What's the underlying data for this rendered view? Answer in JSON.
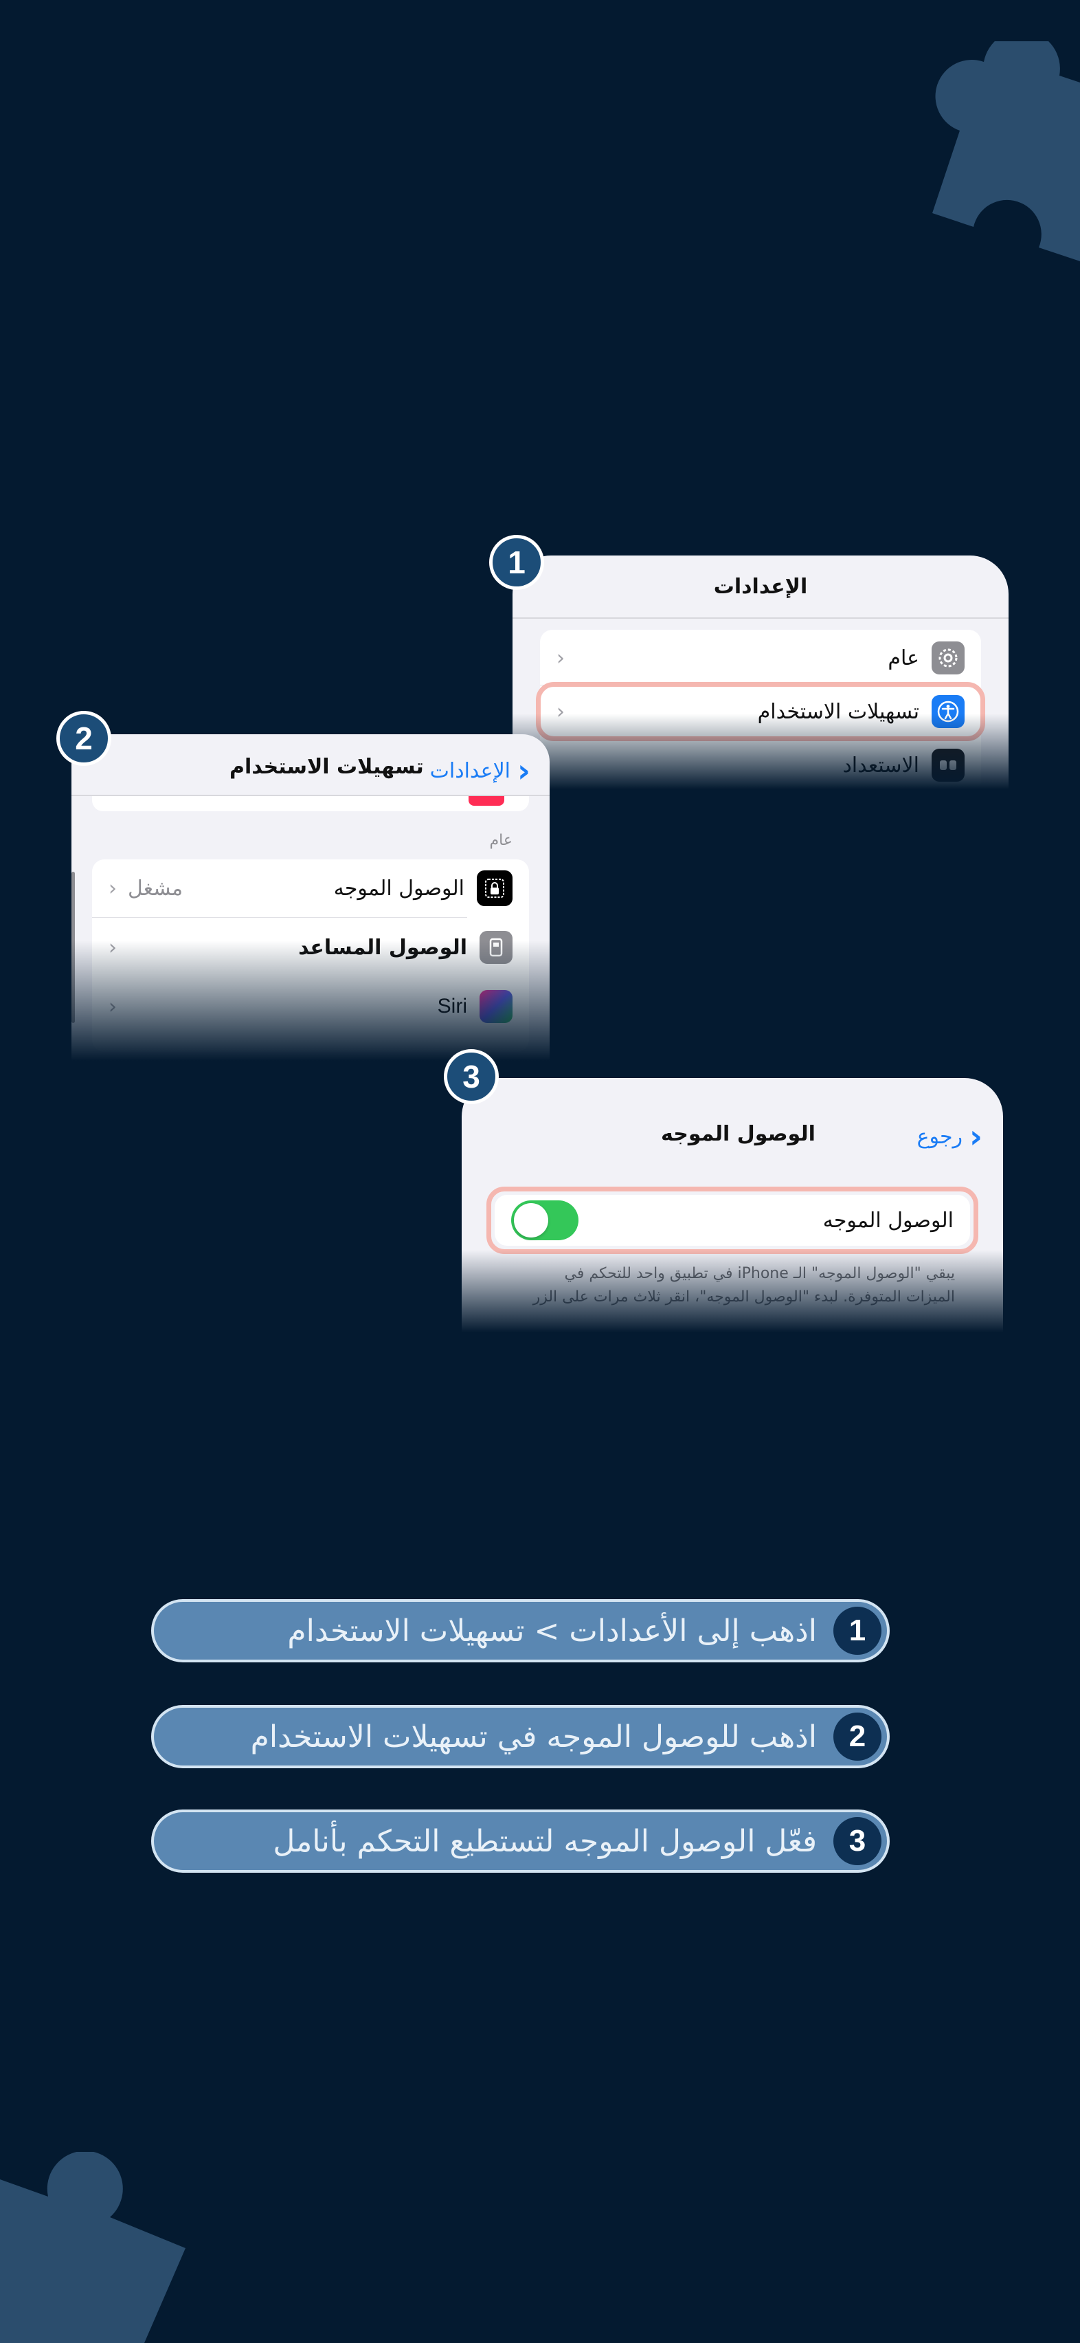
{
  "card1": {
    "badge": "1",
    "title": "الإعدادات",
    "rows": [
      {
        "label": "عام",
        "icon": "gear-icon"
      },
      {
        "label": "تسهيلات الاستخدام",
        "icon": "accessibility-icon"
      },
      {
        "label": "الاستعداد",
        "icon": "standby-icon"
      }
    ]
  },
  "card2": {
    "badge": "2",
    "back_label": "الإعدادات",
    "title": "تسهيلات الاستخدام",
    "section_header": "عام",
    "rows": [
      {
        "label": "الوصول الموجه",
        "value": "مشغل",
        "icon": "lock-icon"
      },
      {
        "label": "الوصول المساعد",
        "icon": "assistive-access-icon"
      },
      {
        "label": "Siri",
        "icon": "siri-icon"
      }
    ]
  },
  "card3": {
    "badge": "3",
    "back_label": "رجوع",
    "title": "الوصول الموجه",
    "toggle_label": "الوصول الموجه",
    "toggle_on": true,
    "footer_line1": "يبقي \"الوصول الموجه\" الـ iPhone في تطبيق واحد للتحكم في",
    "footer_line2": "الميزات المتوفرة. لبدء \"الوصول الموجه\"، انقر ثلاث مرات على الزر"
  },
  "steps": [
    {
      "num": "1",
      "text": "اذهب إلى الأعدادات > تسهيلات الاستخدام"
    },
    {
      "num": "2",
      "text": "اذهب للوصول الموجه في تسهيلات الاستخدام"
    },
    {
      "num": "3",
      "text": "فعّل الوصول الموجه لتستطيع التحكم بأنامل"
    }
  ],
  "colors": {
    "background": "#041a30",
    "puzzle": "#2b4d6d",
    "accent_blue": "#1a7cf5",
    "highlight": "#f5b7b0",
    "toggle_green": "#34c759",
    "step_fill": "#5a87b2"
  }
}
